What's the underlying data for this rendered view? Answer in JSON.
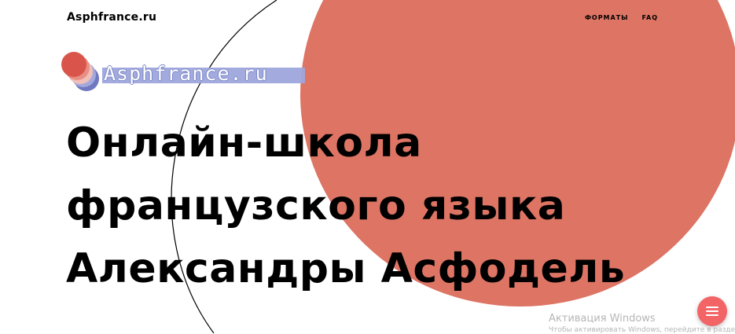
{
  "header": {
    "logo": "Asphfrance.ru",
    "nav": [
      "ФОРМАТЫ",
      "FAQ"
    ]
  },
  "brand_badge": {
    "text": "Asphfrance.ru"
  },
  "hero": {
    "headline_lines": [
      "Онлайн-школа",
      "французского языка",
      "Александры Асфодель"
    ]
  },
  "os_watermark": {
    "title": "Активация Windows",
    "subtitle": "Чтобы активировать Windows, перейдите в раздел"
  },
  "menu_button": {
    "icon": "hamburger-icon"
  },
  "colors": {
    "accent_circle": "#dd7464",
    "menu_button": "#f26466",
    "badge_background": "#9ea6dc"
  }
}
